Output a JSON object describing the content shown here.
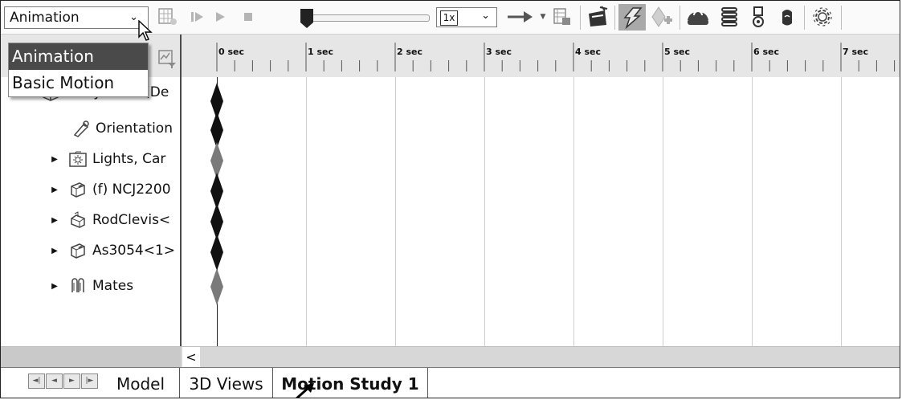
{
  "toolbar": {
    "study_type_value": "Animation",
    "speed_value": "1x"
  },
  "dropdown": {
    "items": [
      "Animation",
      "Basic Motion"
    ]
  },
  "tree": {
    "items": [
      {
        "label": "AirCylinder  (De",
        "icon": "assembly-icon"
      },
      {
        "label": "Orientation",
        "icon": "camera-icon"
      },
      {
        "label": "Lights, Car",
        "icon": "lights-folder-icon"
      },
      {
        "label": "(f) NCJ2200",
        "icon": "part-icon"
      },
      {
        "label": "RodClevis<",
        "icon": "part-icon"
      },
      {
        "label": "As3054<1>",
        "icon": "part-icon"
      },
      {
        "label": "Mates",
        "icon": "mates-icon"
      }
    ]
  },
  "timeline": {
    "ticks": [
      "0 sec",
      "1 sec",
      "2 sec",
      "3 sec",
      "4 sec",
      "5 sec",
      "6 sec",
      "7 sec"
    ]
  },
  "tabs": {
    "model": "Model",
    "views": "3D Views",
    "motion": "Motion Study 1"
  },
  "scroll_left_glyph": "<",
  "colors": {
    "selected_menu_bg": "#4a4a4a",
    "header_bg": "#e6e6e6",
    "key_dark": "#111111",
    "key_gray": "#7a7a7a"
  }
}
